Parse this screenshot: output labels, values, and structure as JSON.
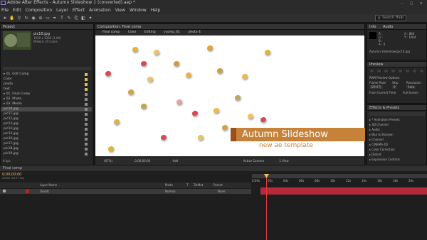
{
  "app": {
    "title": "Adobe After Effects - Autumn Slideshow 1 (converted).aep *",
    "menu": [
      "File",
      "Edit",
      "Composition",
      "Layer",
      "Effect",
      "Animation",
      "View",
      "Window",
      "Help"
    ],
    "search_placeholder": "Search Help",
    "window_controls": "– □ ×"
  },
  "project": {
    "header": "Project",
    "item_name": "pic10.jpg",
    "item_info1": "1920 x 1280 (1.00)",
    "item_info2": "Millions of Colors",
    "tree": [
      {
        "label": "01. Edit Comp",
        "color": "#d8c34a"
      },
      {
        "label": "Color",
        "color": "#d8c34a"
      },
      {
        "label": "photo",
        "color": "#d8c34a"
      },
      {
        "label": "text",
        "color": "#d8c34a"
      },
      {
        "label": "01. Final Comp",
        "color": "#8d8d8d"
      },
      {
        "label": "02. Photo",
        "color": "#8d8d8d"
      },
      {
        "label": "03. Media",
        "color": "#8d8d8d"
      },
      {
        "label": "pic10.jpg",
        "color": "#8d8d8d"
      },
      {
        "label": "pic11.jpg",
        "color": "#8d8d8d"
      },
      {
        "label": "pic12.jpg",
        "color": "#8d8d8d"
      },
      {
        "label": "pic13.jpg",
        "color": "#8d8d8d"
      },
      {
        "label": "pic14.jpg",
        "color": "#8d8d8d"
      },
      {
        "label": "pic15.jpg",
        "color": "#8d8d8d"
      },
      {
        "label": "pic16.jpg",
        "color": "#8d8d8d"
      },
      {
        "label": "pic17.jpg",
        "color": "#8d8d8d"
      },
      {
        "label": "pic18.jpg",
        "color": "#8d8d8d"
      },
      {
        "label": "pic19.jpg",
        "color": "#8d8d8d"
      }
    ],
    "footer_bpc": "8 bpc"
  },
  "composition": {
    "header": "Composition: Final comp",
    "tabs": [
      "Final comp",
      "Color",
      "Editing",
      "vcomp_01",
      "photo 4"
    ],
    "banner_title": "Autumn Slideshow",
    "banner_subtitle": "new ae template",
    "footer_zoom": "(67%)",
    "footer_time": "0;00;00;00",
    "footer_quality": "Half",
    "footer_camera": "Active Camera",
    "footer_view": "1 View"
  },
  "info": {
    "tabs": [
      "Info",
      "Audio"
    ],
    "r": "R :",
    "g": "G :",
    "b": "B :",
    "a": "A : 0",
    "x": "X : 880",
    "y": "Y : 1004",
    "path": "Autumn Slideshow/pic10.jpg",
    "preview_header": "Preview",
    "ram_options": "RAM Preview Options",
    "frame_rate_label": "Frame Rate",
    "skip_label": "Skip",
    "resolution_label": "Resolution",
    "frame_rate": "(29.97)",
    "skip": "0",
    "resolution": "Auto",
    "from_current": "From Current Time",
    "full_screen": "Full Screen",
    "effects_header": "Effects & Presets",
    "effects": [
      "* Animation Presets",
      "3D Channel",
      "Audio",
      "Blur & Sharpen",
      "Channel",
      "CINEMA 4D",
      "Color Correction",
      "Distort",
      "Expression Controls"
    ]
  },
  "timeline": {
    "tab": "Final comp",
    "time": "0;00;00;00",
    "fps": "00000 (29.97 fps)",
    "col_headers": [
      "Layer Name",
      "Mode",
      "T",
      "TrkMat",
      "Parent"
    ],
    "layer_name": "[Solid]",
    "layer_mode": "Normal",
    "layer_parent": "None",
    "ruler": [
      "0:00s",
      "02s",
      "04s",
      "06s",
      "08s",
      "10s",
      "12s",
      "14s",
      "16s",
      "18s",
      "20s"
    ]
  }
}
